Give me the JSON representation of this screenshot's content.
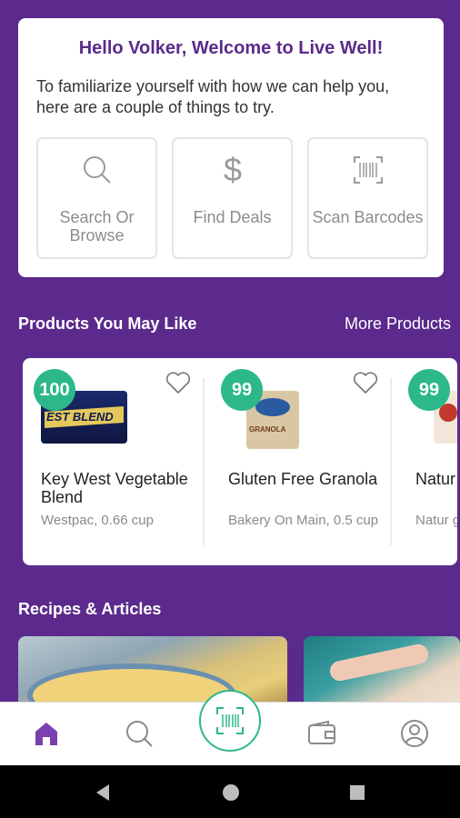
{
  "welcome": {
    "title": "Hello Volker, Welcome to Live Well!",
    "intro": "To familiarize yourself with how we can help you, here are a couple of things to try.",
    "actions": [
      {
        "label": "Search Or Browse",
        "icon": "search-icon"
      },
      {
        "label": "Find Deals",
        "icon": "dollar-icon"
      },
      {
        "label": "Scan Barcodes",
        "icon": "barcode-icon"
      }
    ]
  },
  "products": {
    "title": "Products You May Like",
    "more_label": "More Products",
    "items": [
      {
        "score": "100",
        "name": "Key West Vegetable Blend",
        "meta": "Westpac, 0.66 cup",
        "image_text": "EST BLEND"
      },
      {
        "score": "99",
        "name": "Gluten Free Granola",
        "meta": "Bakery On Main, 0.5 cup",
        "image_text": "GRANOLA"
      },
      {
        "score": "99",
        "name": "Natur Qi'a,",
        "meta": "Natur g",
        "image_text": ""
      }
    ]
  },
  "recipes": {
    "title": "Recipes & Articles"
  },
  "colors": {
    "brand_purple": "#5b2a8c",
    "score_green": "#2cb88a"
  },
  "nav": {
    "items": [
      "home-icon",
      "search-icon",
      "scan-icon",
      "wallet-icon",
      "profile-icon"
    ]
  }
}
